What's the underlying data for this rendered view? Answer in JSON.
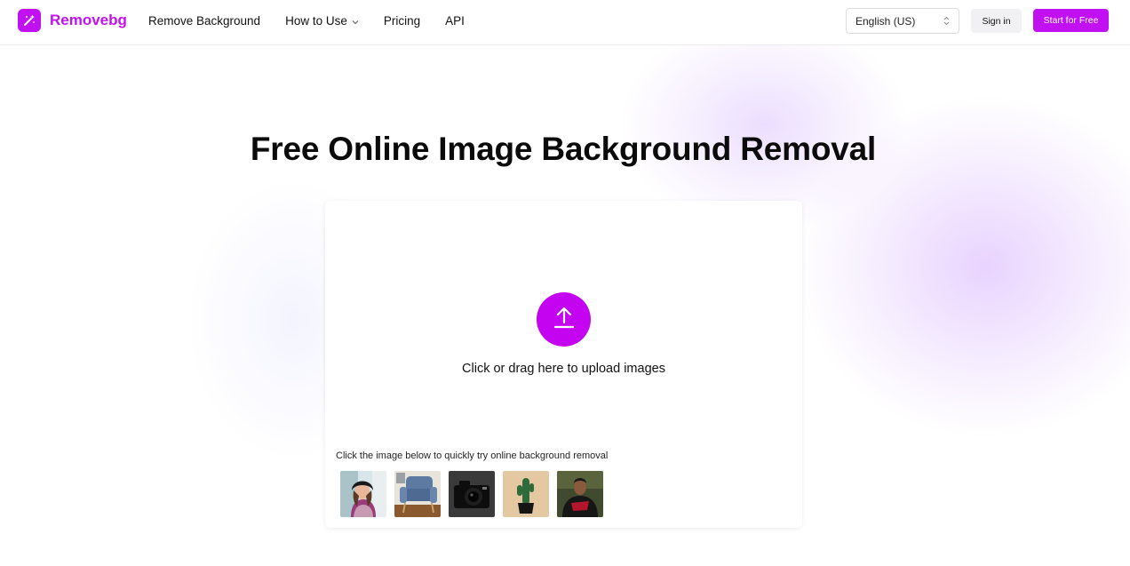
{
  "brand": {
    "name": "Removebg",
    "accent": "#c111f2"
  },
  "nav": {
    "items": [
      {
        "label": "Remove Background"
      },
      {
        "label": "How to Use"
      },
      {
        "label": "Pricing"
      },
      {
        "label": "API"
      }
    ]
  },
  "header": {
    "language": "English (US)",
    "sign_in": "Sign in",
    "start": "Start for Free"
  },
  "main": {
    "title": "Free Online Image Background Removal",
    "upload_text": "Click or drag here to upload images",
    "try_text": "Click the image below to quickly try online background removal",
    "samples": [
      {
        "icon": "woman-portrait-sample"
      },
      {
        "icon": "armchair-sample"
      },
      {
        "icon": "camera-sample"
      },
      {
        "icon": "cactus-sample"
      },
      {
        "icon": "man-hoodie-sample"
      }
    ]
  }
}
